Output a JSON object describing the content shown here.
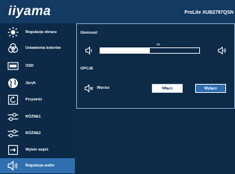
{
  "header": {
    "brand": "iiyama",
    "model": "ProLite XUB2797QSN"
  },
  "sidebar": {
    "items": [
      {
        "label": "Regulacja obrazu",
        "icon": "brightness-icon"
      },
      {
        "label": "Ustawienia kolorów",
        "icon": "color-settings-icon"
      },
      {
        "label": "OSD",
        "icon": "osd-icon"
      },
      {
        "label": "Język",
        "icon": "globe-icon"
      },
      {
        "label": "Przywróć",
        "icon": "reset-icon"
      },
      {
        "label": "RÓŻNE1",
        "icon": "sliders-icon"
      },
      {
        "label": "RÓŻNE2",
        "icon": "sliders-icon"
      },
      {
        "label": "Wybór wejść",
        "icon": "input-select-icon"
      },
      {
        "label": "Regulacja audio",
        "icon": "speaker-icon"
      }
    ],
    "active_index": 8
  },
  "panel": {
    "volume_title": "Głośność",
    "volume_value": "50",
    "volume_level": 0.5,
    "options_title": "OPCJE",
    "mute_label": "Wycisz",
    "on_label": "Włącz",
    "off_label": "Wyłącz",
    "selected": "off"
  },
  "colors": {
    "background": "#0d2a47",
    "header": "#133a62",
    "accent": "#2f6fb0"
  }
}
